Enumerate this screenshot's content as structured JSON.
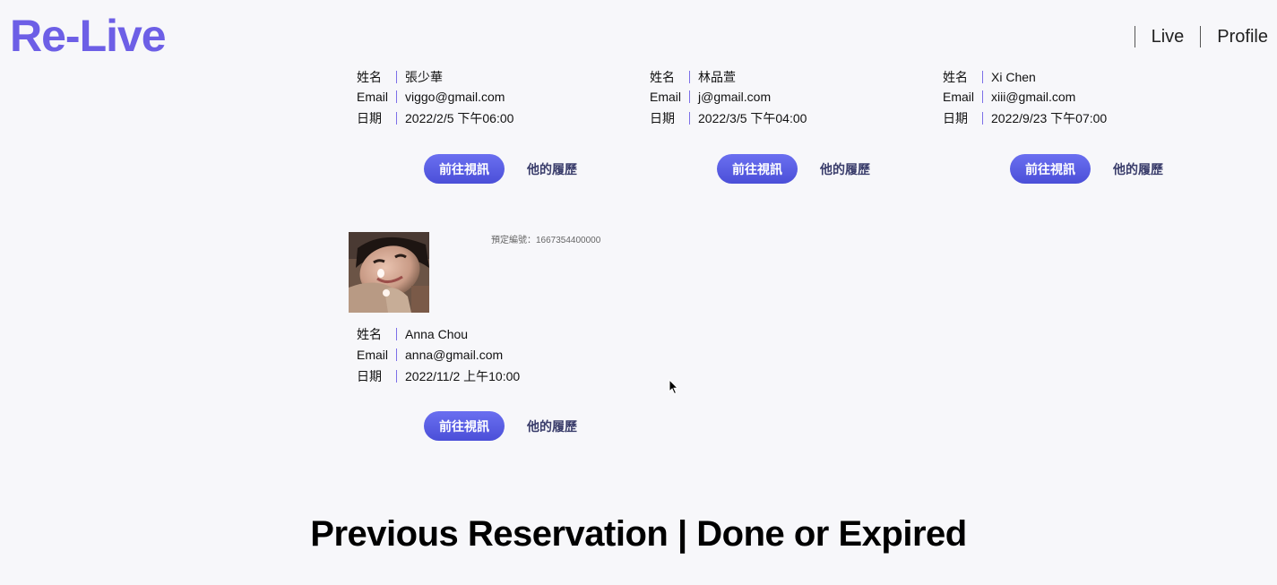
{
  "header": {
    "logo": "Re-Live",
    "nav": [
      {
        "label": "Live"
      },
      {
        "label": "Profile"
      }
    ]
  },
  "reservations": [
    {
      "name_label": "姓名",
      "name": "張少華",
      "email_label": "Email",
      "email": "viggo@gmail.com",
      "date_label": "日期",
      "date": "2022/2/5 下午06:00",
      "video_button": "前往視訊",
      "history_link": "他的履歷"
    },
    {
      "name_label": "姓名",
      "name": "林品萱",
      "email_label": "Email",
      "email": "j@gmail.com",
      "date_label": "日期",
      "date": "2022/3/5 下午04:00",
      "video_button": "前往視訊",
      "history_link": "他的履歷"
    },
    {
      "name_label": "姓名",
      "name": "Xi Chen",
      "email_label": "Email",
      "email": "xiii@gmail.com",
      "date_label": "日期",
      "date": "2022/9/23 下午07:00",
      "video_button": "前往視訊",
      "history_link": "他的履歷"
    },
    {
      "booking_id": "預定編號：1667354400000",
      "name_label": "姓名",
      "name": "Anna Chou",
      "email_label": "Email",
      "email": "anna@gmail.com",
      "date_label": "日期",
      "date": "2022/11/2 上午10:00",
      "video_button": "前往視訊",
      "history_link": "他的履歷"
    }
  ],
  "previous_section": {
    "title": "Previous Reservation | Done or Expired"
  },
  "colors": {
    "brand": "#6d5fe6",
    "button": "#4b4fd8",
    "background": "#f7f7fa"
  }
}
